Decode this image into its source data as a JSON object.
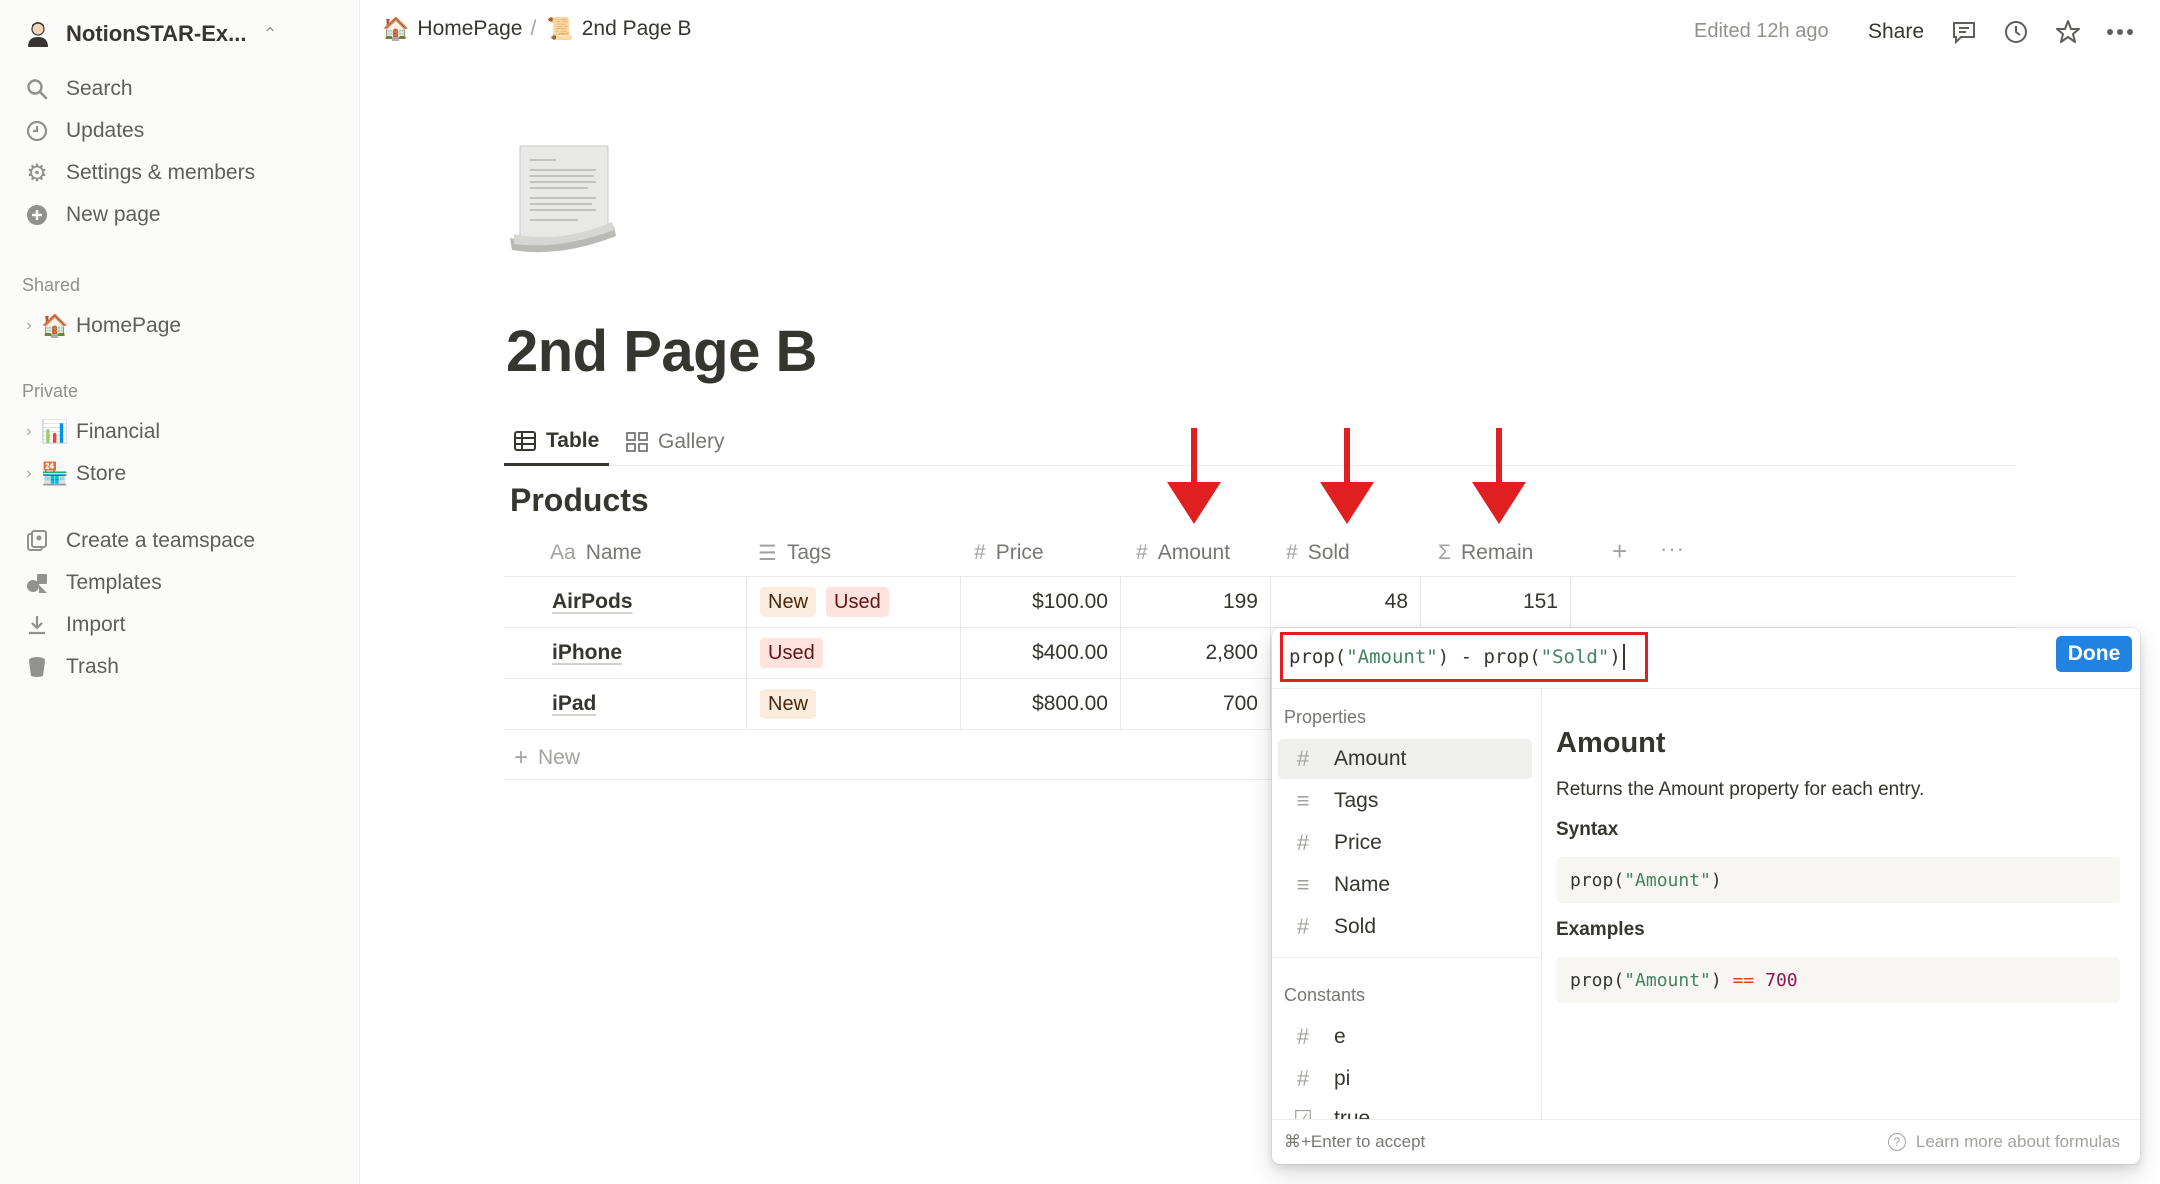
{
  "workspace": {
    "name": "NotionSTAR-Ex..."
  },
  "sidebar": {
    "top_items": [
      {
        "label": "Search",
        "icon": "search-icon"
      },
      {
        "label": "Updates",
        "icon": "clock-icon"
      },
      {
        "label": "Settings & members",
        "icon": "gear-icon"
      },
      {
        "label": "New page",
        "icon": "plus-circle-icon"
      }
    ],
    "shared_header": "Shared",
    "shared_pages": [
      {
        "emoji": "🏠",
        "label": "HomePage"
      }
    ],
    "private_header": "Private",
    "private_pages": [
      {
        "emoji": "📊",
        "label": "Financial"
      },
      {
        "emoji": "🏪",
        "label": "Store"
      }
    ],
    "bottom_items": [
      {
        "label": "Create a teamspace",
        "icon": "teamspace-icon"
      },
      {
        "label": "Templates",
        "icon": "templates-icon"
      },
      {
        "label": "Import",
        "icon": "download-icon"
      },
      {
        "label": "Trash",
        "icon": "trash-icon"
      }
    ]
  },
  "topbar": {
    "breadcrumb": [
      {
        "emoji": "🏠",
        "label": "HomePage"
      },
      {
        "emoji": "📜",
        "label": "2nd Page B"
      }
    ],
    "breadcrumb_sep": "/",
    "edited": "Edited 12h ago",
    "share": "Share"
  },
  "page": {
    "title": "2nd Page B",
    "views": [
      {
        "label": "Table"
      },
      {
        "label": "Gallery"
      }
    ],
    "database_title": "Products"
  },
  "table": {
    "columns": [
      {
        "icon": "Aa",
        "label": "Name"
      },
      {
        "icon": "☰",
        "label": "Tags"
      },
      {
        "icon": "#",
        "label": "Price"
      },
      {
        "icon": "#",
        "label": "Amount"
      },
      {
        "icon": "#",
        "label": "Sold"
      },
      {
        "icon": "Σ",
        "label": "Remain"
      }
    ],
    "rows": [
      {
        "name": "AirPods",
        "tags": [
          "New",
          "Used"
        ],
        "price": "$100.00",
        "amount": "199",
        "sold": "48",
        "remain": "151"
      },
      {
        "name": "iPhone",
        "tags": [
          "Used"
        ],
        "price": "$400.00",
        "amount": "2,800",
        "sold": "",
        "remain": ""
      },
      {
        "name": "iPad",
        "tags": [
          "New"
        ],
        "price": "$800.00",
        "amount": "700",
        "sold": "",
        "remain": ""
      }
    ],
    "new_label": "New"
  },
  "formula": {
    "seg1": "prop(",
    "str1": "\"Amount\"",
    "seg2": ") - prop(",
    "str2": "\"Sold\"",
    "seg3": ")",
    "done": "Done",
    "properties_header": "Properties",
    "properties": [
      {
        "icon": "#",
        "label": "Amount"
      },
      {
        "icon": "≡",
        "label": "Tags"
      },
      {
        "icon": "#",
        "label": "Price"
      },
      {
        "icon": "≡",
        "label": "Name"
      },
      {
        "icon": "#",
        "label": "Sold"
      }
    ],
    "constants_header": "Constants",
    "constants": [
      {
        "icon": "#",
        "label": "e"
      },
      {
        "icon": "#",
        "label": "pi"
      },
      {
        "icon": "☑",
        "label": "true"
      }
    ],
    "doc": {
      "title": "Amount",
      "description": "Returns the Amount property for each entry.",
      "syntax_header": "Syntax",
      "syntax_fn": "prop(",
      "syntax_str": "\"Amount\"",
      "syntax_end": ")",
      "examples_header": "Examples",
      "ex_fn": "prop(",
      "ex_str": "\"Amount\"",
      "ex_close": ") ",
      "ex_op": "==",
      "ex_num": " 700"
    },
    "footer_hint": "⌘+Enter to accept",
    "footer_link": "Learn more about formulas"
  },
  "colors": {
    "accent": "#2383e2",
    "annotation_red": "#e02020",
    "tag_new": "#fbecdd",
    "tag_used": "#fde2dd"
  }
}
